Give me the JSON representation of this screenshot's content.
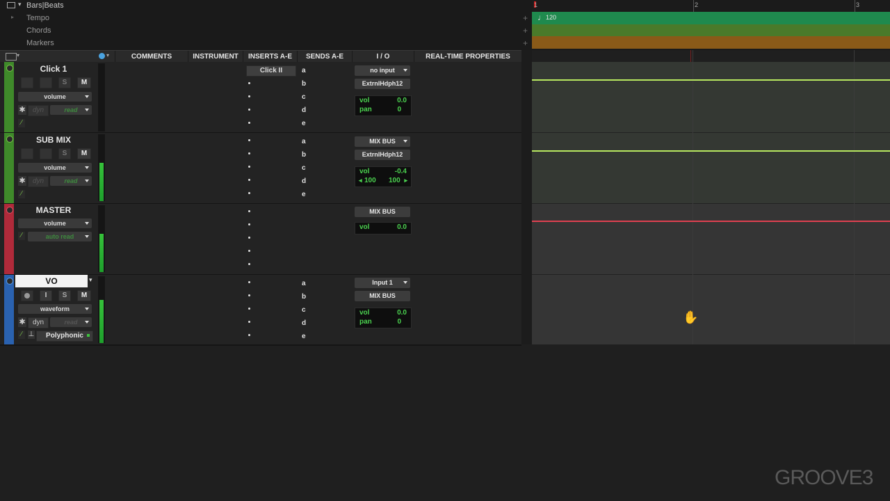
{
  "rulers": {
    "bars_beats": "Bars|Beats",
    "tempo": "Tempo",
    "chords": "Chords",
    "markers": "Markers",
    "tempo_value": "120",
    "bar_1": "1",
    "bar_2": "2",
    "bar_3": "3"
  },
  "columns": {
    "comments": "COMMENTS",
    "instrument": "INSTRUMENT",
    "inserts": "INSERTS A-E",
    "sends": "SENDS A-E",
    "io": "I / O",
    "rtp": "REAL-TIME PROPERTIES"
  },
  "send_letters": [
    "a",
    "b",
    "c",
    "d",
    "e"
  ],
  "tracks": [
    {
      "name": "Click 1",
      "solo": "S",
      "mute": "M",
      "view": "volume",
      "dyn": "dyn",
      "automation": "read",
      "insert_a": "Click II",
      "input": "no input",
      "output": "ExtrnlHdph12",
      "vol_label": "vol",
      "vol_value": "0.0",
      "pan_label": "pan",
      "pan_value": "0"
    },
    {
      "name": "SUB MIX",
      "solo": "S",
      "mute": "M",
      "view": "volume",
      "dyn": "dyn",
      "automation": "read",
      "input": "MIX BUS",
      "output": "ExtrnlHdph12",
      "vol_label": "vol",
      "vol_value": "-0.4",
      "pan_left": "100",
      "pan_right": "100"
    },
    {
      "name": "MASTER",
      "view": "volume",
      "automation": "auto read",
      "output": "MIX BUS",
      "vol_label": "vol",
      "vol_value": "0.0"
    },
    {
      "name": "VO",
      "input_monitor": "I",
      "solo": "S",
      "mute": "M",
      "view": "waveform",
      "dyn": "dyn",
      "automation": "read",
      "elastic": "Polyphonic",
      "input": "Input 1",
      "output": "MIX BUS",
      "vol_label": "vol",
      "vol_value": "0.0",
      "pan_label": "pan",
      "pan_value": "0"
    }
  ],
  "watermark": "GROOVE3",
  "colors": {
    "tempo_ruler": "#1f8a4e",
    "chords_ruler": "#4a7a2a",
    "markers_ruler": "#8a5a18",
    "click_track": "#3f8a2a",
    "submix_track": "#3f8a2a",
    "master_track": "#b02a3a",
    "vo_track": "#2a62b0",
    "volume_line_green": "#b8e860",
    "volume_line_red": "#e04050",
    "meter_green": "#2fb83a"
  }
}
